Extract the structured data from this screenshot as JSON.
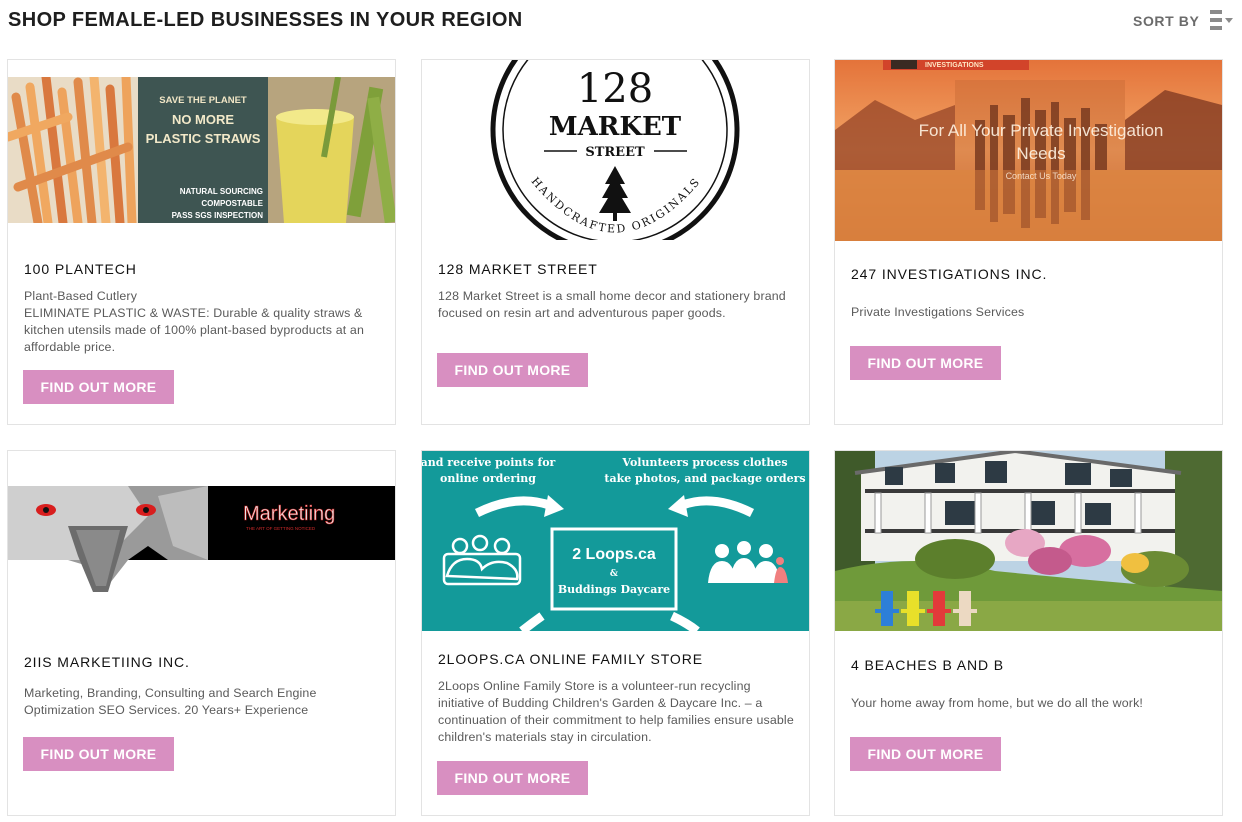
{
  "header": {
    "title": "SHOP FEMALE-LED BUSINESSES IN YOUR REGION",
    "sort_label": "SORT BY",
    "sort_icon": "list-sort-icon"
  },
  "colors": {
    "button": "#d88fc1",
    "card_border": "#e3e3e3",
    "description_text": "#5a5a5a"
  },
  "businesses": [
    {
      "name": "100 PLANTECH",
      "description": "Plant-Based Cutlery\nELIMINATE PLASTIC & WASTE: Durable & quality straws & kitchen utensils made of 100% plant-based byproducts at an affordable price.",
      "button_label": "FIND OUT MORE",
      "image_text": [
        "SAVE THE PLANET",
        "NO MORE",
        "PLASTIC STRAWS",
        "NATURAL SOURCING",
        "COMPOSTABLE",
        "PASS SGS INSPECTION"
      ]
    },
    {
      "name": "128 MARKET STREET",
      "description": "128 Market Street is a small home decor and stationery brand focused on resin art and adventurous paper goods.",
      "button_label": "FIND OUT MORE",
      "image_text": [
        "128",
        "MARKET",
        "STREET",
        "HANDCRAFTED ORIGINALS"
      ]
    },
    {
      "name": "247 INVESTIGATIONS INC.",
      "description": "Private Investigations Services",
      "button_label": "FIND OUT MORE",
      "image_text": [
        "INVESTIGATIONS",
        "For All Your Private Investigation",
        "Needs",
        "Contact Us Today"
      ]
    },
    {
      "name": "2IIS MARKETIING INC.",
      "description": "Marketing, Branding, Consulting and Search Engine Optimization SEO Services. 20 Years+ Experience",
      "button_label": "FIND OUT MORE",
      "image_text": [
        "Marketiing",
        "THE ART OF GETTING NOTICED"
      ]
    },
    {
      "name": "2LOOPS.CA ONLINE FAMILY STORE",
      "description": "2Loops Online Family Store is a volunteer-run recycling initiative of Budding Children's Garden & Daycare Inc. – a continuation of their commitment to help families ensure usable children's materials stay in circulation.",
      "button_label": "FIND OUT MORE",
      "image_text": [
        "and receive points for",
        "online ordering",
        "Volunteers process clothes",
        "take photos, and package orders",
        "2 Loops.ca",
        "&",
        "Buddings Daycare"
      ]
    },
    {
      "name": "4 BEACHES B AND B",
      "description": "Your home away from home, but we do all the work!",
      "button_label": "FIND OUT MORE",
      "image_text": []
    }
  ]
}
